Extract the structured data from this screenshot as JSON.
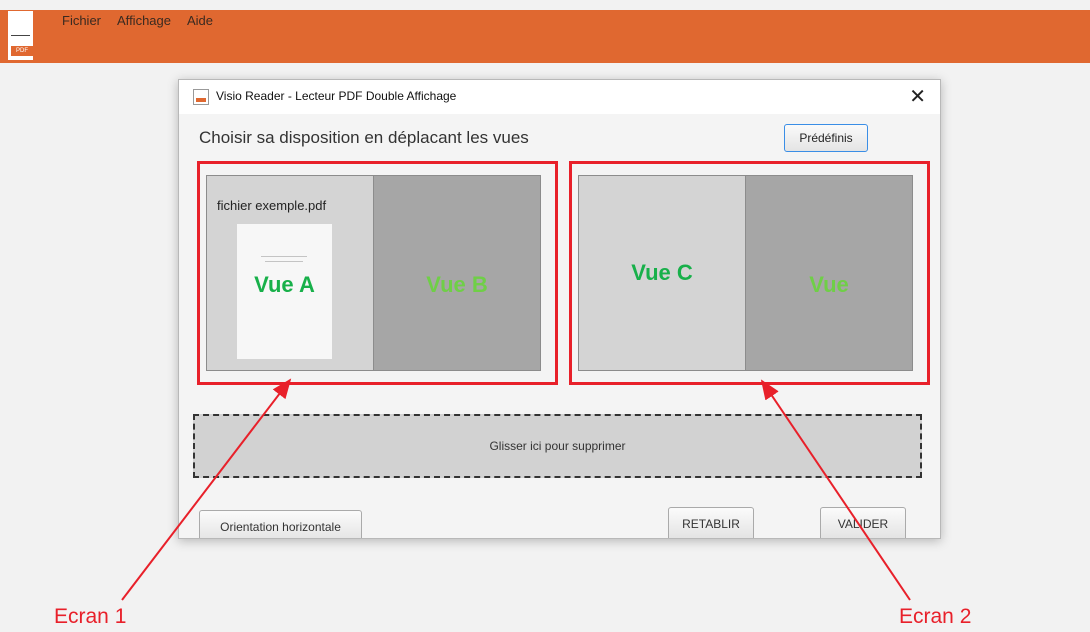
{
  "app": {
    "icon_tag": "PDF",
    "menu": [
      {
        "label": "Fichier"
      },
      {
        "label": "Affichage"
      },
      {
        "label": "Aide"
      }
    ]
  },
  "dialog": {
    "title": "Visio Reader - Lecteur PDF Double Affichage",
    "heading": "Choisir sa disposition en déplacant les vues",
    "predefined_label": "Prédéfinis",
    "screen1": {
      "file_name": "fichier exemple.pdf",
      "view_a": "Vue A",
      "view_b": "Vue B"
    },
    "screen2": {
      "view_c": "Vue C",
      "view_d": "Vue"
    },
    "dropzone_label": "Glisser ici pour supprimer",
    "orientation_label": "Orientation horizontale",
    "reset_label": "RETABLIR",
    "validate_label": "VALIDER"
  },
  "annotations": {
    "screen1_caption": "Ecran 1",
    "screen2_caption": "Ecran 2"
  },
  "colors": {
    "app_bar": "#e06830",
    "highlight_red": "#e8202a",
    "view_label_green": "#18b04a",
    "view_label_faint_green": "#6fcf47"
  }
}
